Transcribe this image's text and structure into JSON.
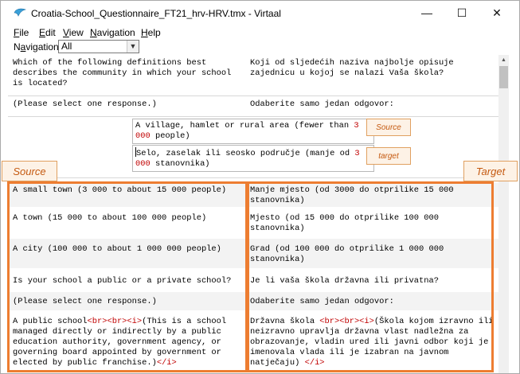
{
  "window": {
    "title": "Croatia-School_Questionnaire_FT21_hrv-HRV.tmx - Virtaal",
    "minimize": "—",
    "maximize": "☐",
    "close": "✕"
  },
  "menu": {
    "file": "File",
    "edit": "Edit",
    "view": "View",
    "navigation": "Navigation",
    "help": "Help"
  },
  "navigation": {
    "label": "Navigation:",
    "selected": "All"
  },
  "segments": [
    {
      "source": "Which of the following definitions best describes the community in which your school is located?",
      "target": "Koji od sljedećih naziva najbolje opisuje zajednicu u kojoj se nalazi Vaša škola?"
    },
    {
      "source": "(Please select one response.)",
      "target": "Odaberite samo jedan odgovor:"
    }
  ],
  "editor": {
    "source_main": "A village, hamlet or rural area (fewer than ",
    "source_num1": "3",
    "source_num2": "000",
    "source_end": " people)",
    "target_main": "Selo, zaselak ili seosko područje (manje od ",
    "target_num1": "3",
    "target_num2": "000",
    "target_end": " stanovnika)"
  },
  "rows": [
    {
      "source": "A small town (3 000 to about 15 000 people)",
      "target": "Manje mjesto (od 3000 do otprilike 15 000 stanovnika)"
    },
    {
      "source": "A town (15 000 to about 100 000 people)",
      "target": "Mjesto (od 15 000 do otprilike 100 000 stanovnika)"
    },
    {
      "source": "A city (100 000 to about 1 000 000 people)",
      "target": "Grad (od 100 000 do otprilike 1 000 000 stanovnika)"
    },
    {
      "source": "Is your school a public or a private school?",
      "target": "Je li vaša škola državna ili privatna?"
    },
    {
      "source": "(Please select one response.)",
      "target": "Odaberite samo jedan odgovor:"
    }
  ],
  "last_row": {
    "source_a": "A public school",
    "source_tags": "<br><br><i>",
    "source_b": "(This is a school managed directly or indirectly by a public education authority, government agency, or governing board appointed by government or elected by public franchise.)",
    "source_end_tag": "</i>",
    "target_a": "Državna škola ",
    "target_tags": "<br><br><i>",
    "target_b": "(Škola kojom izravno ili neizravno upravlja državna vlast nadležna za obrazovanje, vladin ured ili javni odbor koji je imenovala vlada ili je izabran na javnom natječaju) ",
    "target_end_tag": "</i>"
  },
  "callouts": {
    "source_small": "Source",
    "target_small": "target",
    "source_big": "Source",
    "target_big": "Target"
  },
  "colors": {
    "accent": "#ed7d31",
    "tag": "#c00000",
    "callout_bg": "#fdf2e6"
  }
}
